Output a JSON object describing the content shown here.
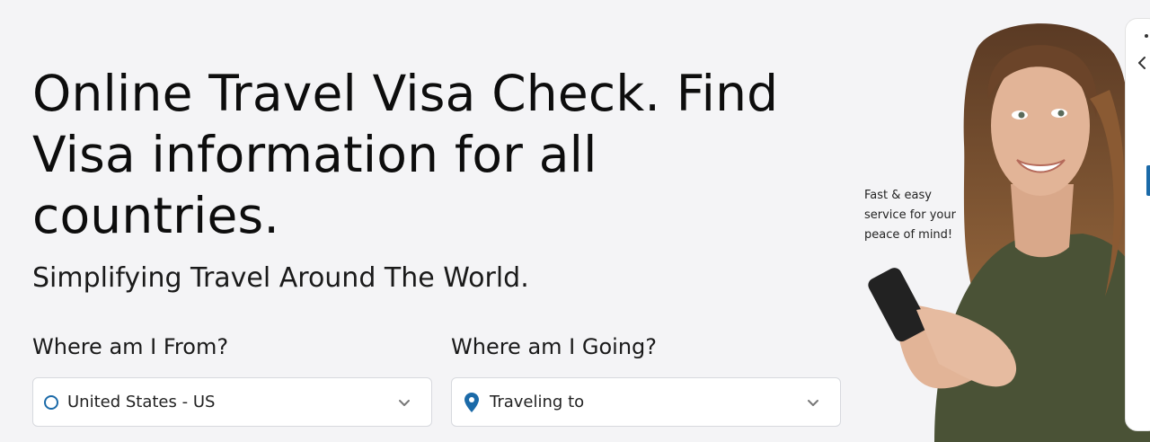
{
  "hero": {
    "title": "Online Travel Visa Check.  Find Visa information for all countries.",
    "subtitle": "Simplifying Travel Around The World."
  },
  "form": {
    "from_label": "Where am I From?",
    "from_value": "United States - US",
    "to_label": "Where am I Going?",
    "to_placeholder": "Traveling to"
  },
  "promo": {
    "caption": "Fast & easy service for your peace of mind!"
  },
  "icons": {
    "from": "circle-icon",
    "to": "map-pin-icon",
    "dropdown": "chevron-down-icon",
    "panel": "chevron-left-icon"
  },
  "colors": {
    "accent": "#1b6aa8",
    "background": "#f4f4f6"
  }
}
